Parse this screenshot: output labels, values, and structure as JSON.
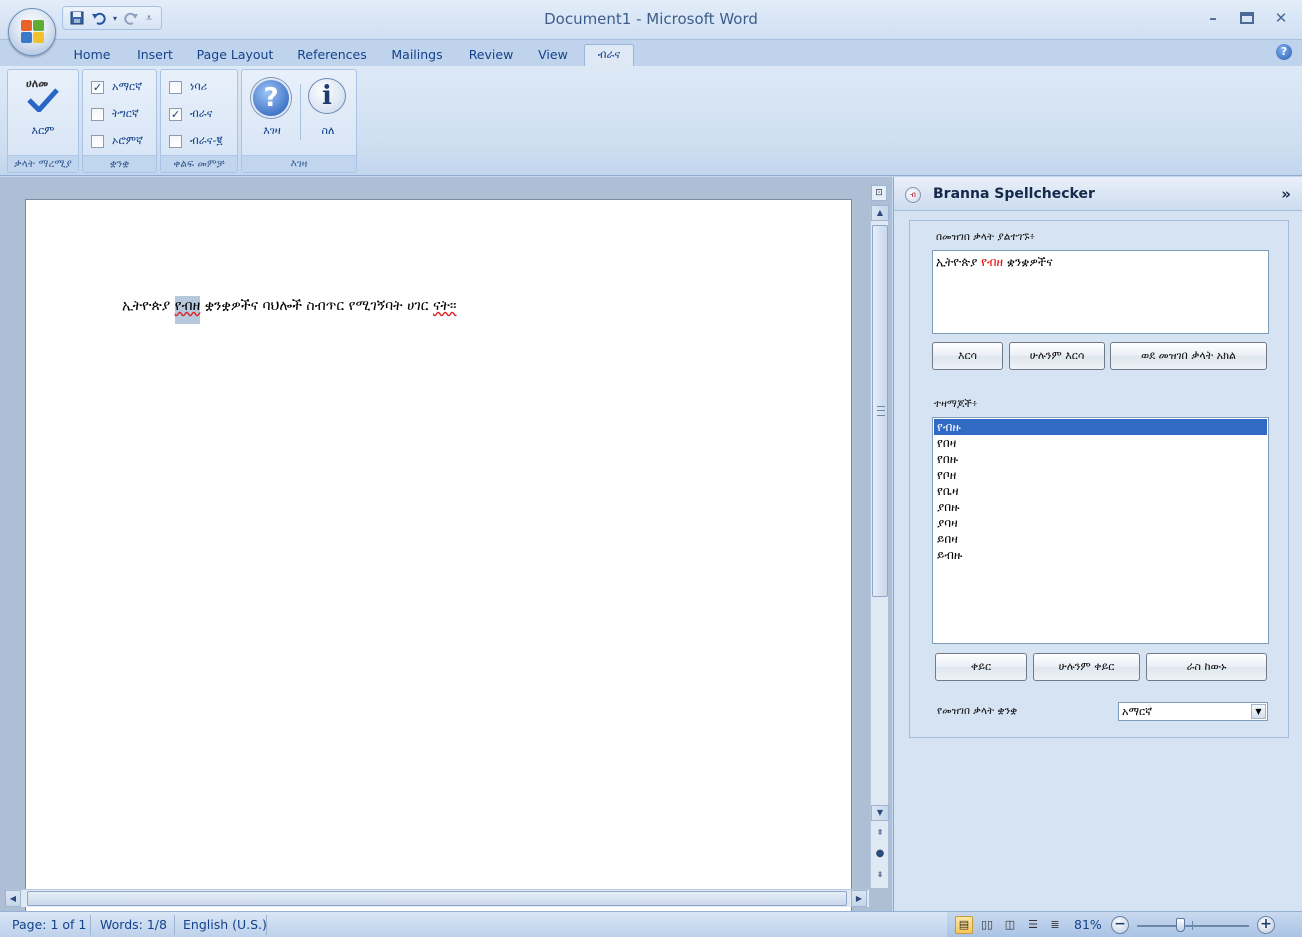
{
  "window": {
    "title": "Document1 - Microsoft Word"
  },
  "qat": {
    "save_icon": "save-icon",
    "undo_icon": "undo-icon",
    "redo_icon": "redo-icon",
    "customize_icon": "qat-customize-icon"
  },
  "tabs": [
    {
      "label": "Home"
    },
    {
      "label": "Insert"
    },
    {
      "label": "Page Layout"
    },
    {
      "label": "References"
    },
    {
      "label": "Mailings"
    },
    {
      "label": "Review"
    },
    {
      "label": "View"
    },
    {
      "label": "ብራና"
    }
  ],
  "ribbon": {
    "groups": [
      {
        "label": "ቃላት ማረሚያ",
        "button_label": "እርም",
        "button_icon_text": "ሀለመ"
      },
      {
        "label": "ቋንቋ",
        "options": [
          {
            "label": "አማርኛ",
            "checked": true
          },
          {
            "label": "ትግርኛ",
            "checked": false
          },
          {
            "label": "ኦሮምኛ",
            "checked": false
          }
        ]
      },
      {
        "label": "ቀልፍ መምቻ",
        "options": [
          {
            "label": "ነባሪ",
            "checked": false
          },
          {
            "label": "ብራና",
            "checked": true
          },
          {
            "label": "ብራና-፪",
            "checked": false
          }
        ]
      },
      {
        "label": "እገዛ",
        "buttons": [
          {
            "label": "እገዛ",
            "icon": "?"
          },
          {
            "label": "ስለ",
            "icon": "i"
          }
        ]
      }
    ]
  },
  "document": {
    "before": "ኢትዮጵያ ",
    "highlighted_word": "የብዘ",
    "after": " ቋንቋዎችና ባህሎች ስብጥር የሚገኝባት ሀገር ",
    "last_word": "ናት፡፡"
  },
  "pane": {
    "title": "Branna Spellchecker",
    "close_icon": "»",
    "not_found_label": "በመዝገበ ቃላት ያልተገኙ፥",
    "not_found": {
      "before": "ኢትዮጵያ ",
      "word": "የብዘ",
      "after": " ቋንቋዎችና"
    },
    "buttons_top": [
      {
        "label": "እርሳ"
      },
      {
        "label": "ሁሉንም እርሳ"
      },
      {
        "label": "ወደ መዝገበ ቃላት አክል"
      }
    ],
    "suggestions_label": "ተዛማጆች፥",
    "suggestions": [
      "የብዙ",
      "የበዛ",
      "የበዙ",
      "የቦዘ",
      "የቤዛ",
      "ያበዙ",
      "ያባዛ",
      "ይበዛ",
      "ይብዙ"
    ],
    "buttons_bottom": [
      {
        "label": "ቀይር"
      },
      {
        "label": "ሁሉንም ቀይር"
      },
      {
        "label": "ራስ ከውኑ"
      }
    ],
    "language_label": "የመዝገበ ቃላት ቋንቋ",
    "language_value": "አማርኛ"
  },
  "status": {
    "page": "Page: 1 of 1",
    "words": "Words: 1/8",
    "language": "English (U.S.)",
    "zoom": "81%"
  }
}
